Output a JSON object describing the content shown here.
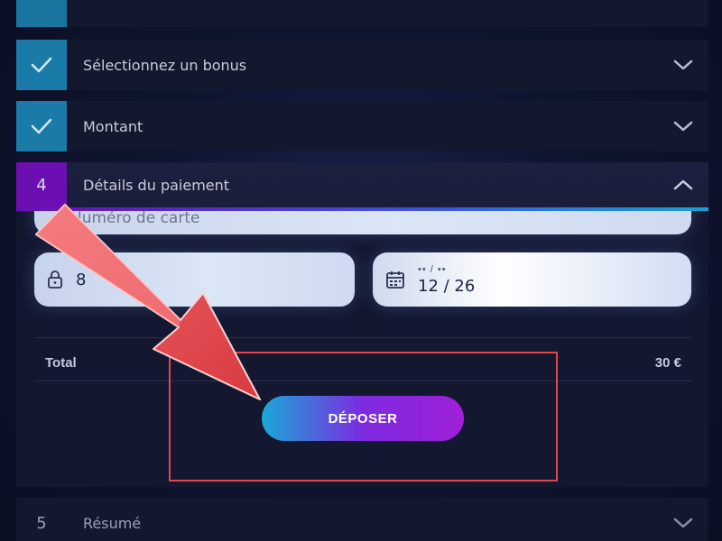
{
  "steps": {
    "bonus": {
      "label": "Sélectionnez un bonus",
      "status": "done"
    },
    "amount": {
      "label": "Montant",
      "status": "done"
    },
    "payment": {
      "number": "4",
      "label": "Détails du paiement",
      "status": "active"
    },
    "summary": {
      "number": "5",
      "label": "Résumé",
      "status": "pending"
    }
  },
  "payment_form": {
    "card_number_placeholder": "Numéro de carte",
    "cvv_value": "8",
    "expiry_label": "•• / ••",
    "expiry_value": "12 / 26"
  },
  "total": {
    "label": "Total",
    "value": "30 €"
  },
  "deposit_button": {
    "label": "DÉPOSER"
  },
  "colors": {
    "done_step": "#1a7aa8",
    "active_step": "#6b0fb3",
    "button_start": "#1aa8d6",
    "button_end": "#a020d8",
    "highlight": "#e0474c"
  },
  "icons": {
    "done_step": "checkmark-icon",
    "collapsed": "chevron-down-icon",
    "expanded": "chevron-up-icon",
    "cvv": "lock-icon",
    "expiry": "calendar-icon",
    "annotation": "red-arrow-icon"
  }
}
